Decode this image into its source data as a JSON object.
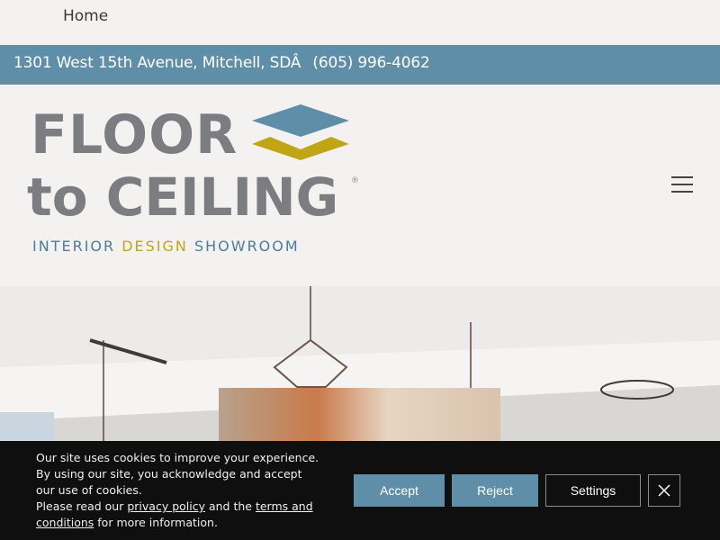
{
  "nav": {
    "home_label": "Home"
  },
  "infobar": {
    "address": "1301 West 15th Avenue, Mitchell, SDÂ ",
    "phone": "(605) 996-4062",
    "bg_color": "#5f8fa8"
  },
  "logo": {
    "line1": "FLOOR",
    "line2": "to CEILING",
    "registered": "®",
    "tagline_left": "INTERIOR ",
    "tagline_mid": "DESIGN",
    "tagline_right": " SHOWROOM",
    "colors": {
      "gray": "#7c7d80",
      "blue": "#5f8fa8",
      "gold": "#c0a514"
    }
  },
  "menu": {
    "icon": "hamburger-menu-icon"
  },
  "cookie": {
    "text_before": "Our site uses cookies to improve your experience. By using our site, you acknowledge and accept our use of cookies.",
    "text_read": "Please read our ",
    "privacy_link": "privacy policy",
    "text_and": " and the ",
    "terms_link": "terms and conditions",
    "text_after": " for more information.",
    "accept_label": "Accept",
    "reject_label": "Reject",
    "settings_label": "Settings",
    "close_icon": "close-icon"
  }
}
